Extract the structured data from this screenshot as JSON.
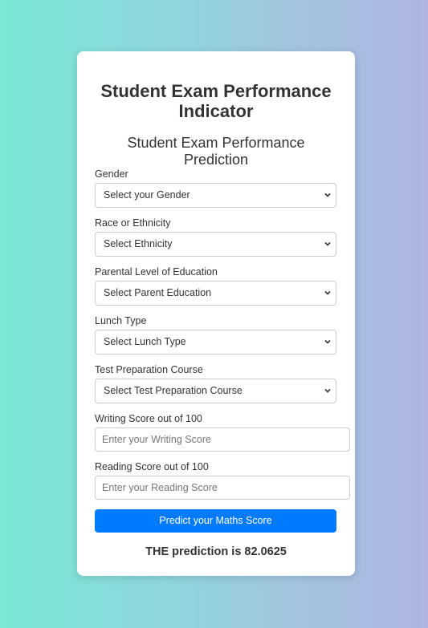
{
  "header": {
    "title": "Student Exam Performance Indicator",
    "subtitle": "Student Exam Performance Prediction"
  },
  "form": {
    "gender": {
      "label": "Gender",
      "value": "Select your Gender"
    },
    "ethnicity": {
      "label": "Race or Ethnicity",
      "value": "Select Ethnicity"
    },
    "parent_education": {
      "label": "Parental Level of Education",
      "value": "Select Parent Education"
    },
    "lunch": {
      "label": "Lunch Type",
      "value": "Select Lunch Type"
    },
    "test_prep": {
      "label": "Test Preparation Course",
      "value": "Select Test Preparation Course"
    },
    "writing_score": {
      "label": "Writing Score out of 100",
      "placeholder": "Enter your Writing Score"
    },
    "reading_score": {
      "label": "Reading Score out of 100",
      "placeholder": "Enter your Reading Score"
    },
    "submit_label": "Predict your Maths Score"
  },
  "result": {
    "text": "THE prediction is 82.0625"
  },
  "colors": {
    "accent": "#007bff",
    "card": "#ffffff"
  },
  "icons": {
    "select_arrow": "chevron-down-icon"
  }
}
